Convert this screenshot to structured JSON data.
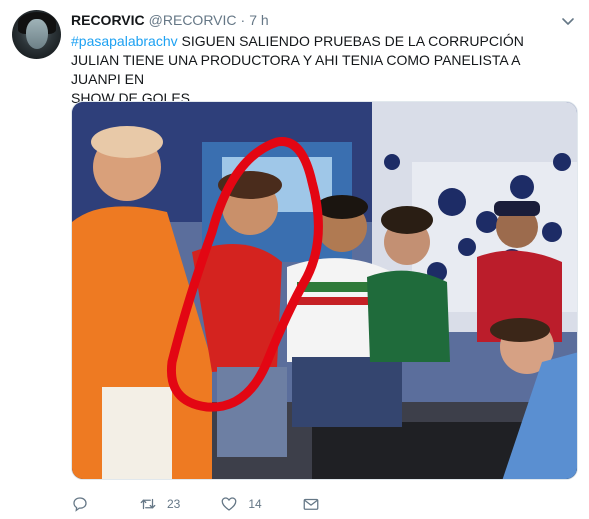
{
  "tweet": {
    "display_name": "RECORVIC",
    "handle": "@RECORVIC",
    "separator": "·",
    "time": "7 h",
    "hashtag": "#pasapalabrachv",
    "text_line1": " SIGUEN SALIENDO PRUEBAS DE LA CORRUPCIÓN",
    "text_line2": "JULIAN TIENE UNA PRODUCTORA Y AHI TENIA COMO PANELISTA A JUANPI EN",
    "text_line3": "SHOW DE GOLES"
  },
  "actions": {
    "reply_count": "",
    "retweet_count": "23",
    "like_count": "14"
  },
  "icons": [
    "avatar",
    "chevron-down-icon",
    "reply-icon",
    "retweet-icon",
    "like-icon",
    "dm-icon"
  ],
  "colors": {
    "hashtag": "#1da1f2",
    "muted": "#657786",
    "circle": "#e30613"
  }
}
